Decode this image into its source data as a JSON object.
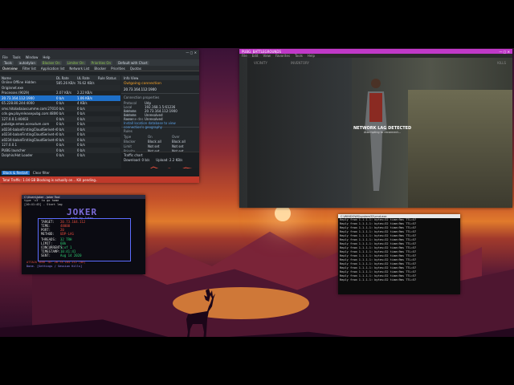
{
  "network_tool": {
    "title": "",
    "menu": [
      "File",
      "Tools",
      "Window",
      "Help"
    ],
    "toolbar_items": [
      "Tools",
      "autodylan",
      "Blocker On",
      "Limiter On",
      "Priorities On",
      "Default with Chart"
    ],
    "tabs": [
      "Overview",
      "Filter list",
      "Application list",
      "Network List",
      "Blocker",
      "Priorities",
      "Quotas"
    ],
    "status_filters": [
      "Online",
      "Offline",
      "Hidden"
    ],
    "columns": [
      "Name",
      "DL Rate",
      "UL Rate",
      "Rule Status"
    ],
    "totals": {
      "dl": "585.26 KB/s",
      "ul": "76.62 KB/s"
    },
    "rows": [
      {
        "name": "Originnet.exe",
        "dl": "",
        "ul": ""
      },
      {
        "name": "Processes (9029)",
        "dl": "2.07 KB/s",
        "ul": "2.22 KB/s"
      },
      {
        "name": "20.73.164.112:1900",
        "dl": "0 b/s",
        "ul": "1.06 KB/s"
      },
      {
        "name": "65.228.80.244:4000",
        "dl": "0 b/s",
        "ul": "4 KB/s"
      },
      {
        "name": "sms.hitoladaiascumme.com:27015",
        "dl": "0 b/s",
        "ul": "0 b/s"
      },
      {
        "name": "cdn.gw.playreleasepubg.com:48000",
        "dl": "0 b/s",
        "ul": "0 b/s"
      },
      {
        "name": "127.0.0.1:40403",
        "dl": "0 b/s",
        "ul": "0 b/s"
      },
      {
        "name": "pubstge.emes.ocesutum.com",
        "dl": "0 b/s",
        "ul": "0 b/s"
      },
      {
        "name": "a0234-balanFirstingCloudSerivet-44",
        "dl": "0 b/s",
        "ul": "0 b/s"
      },
      {
        "name": "a0234-balanFirstingCloudSerivet-44",
        "dl": "0 b/s",
        "ul": "0 b/s"
      },
      {
        "name": "a0234-balanFirstingCloudSerivet-44",
        "dl": "0 b/s",
        "ul": "0 b/s"
      },
      {
        "name": "127.0.0.1",
        "dl": "0 b/s",
        "ul": "0 b/s"
      },
      {
        "name": "PUBG launcher",
        "dl": "0 b/s",
        "ul": "0 b/s"
      },
      {
        "name": "Dolphin/Hot Loader",
        "dl": "0 b/s",
        "ul": "0 b/s"
      }
    ],
    "info_view": {
      "header": "Info View",
      "title": "Outgoing connection",
      "subtitle": "20.73.164.112:1900",
      "section": "Connection properties",
      "props": [
        [
          "Protocol",
          "Udp"
        ],
        [
          "Local address",
          "192.168.1.5:61236"
        ],
        [
          "Remote address",
          "20.73.164.112:1900"
        ],
        [
          "Remote name",
          "Unresolved"
        ],
        [
          "Reverse dns",
          "Unresolved"
        ]
      ],
      "hint": "Install location database to view connection's geography",
      "rules_header": "Rules",
      "rules_cols": [
        "Type",
        "On",
        "Over"
      ],
      "rules": [
        [
          "Blocker",
          "Block all",
          "Block all"
        ],
        [
          "Limit",
          "Not set",
          "Not set"
        ],
        [
          "Priority",
          "Not set",
          "Not set"
        ],
        [
          "Quota",
          "Not set",
          "Not set"
        ]
      ],
      "traffic_chart": "Traffic chart",
      "download_rate": "Download: 0 b/s",
      "upload_rate": "Upload: 2.2 KB/s"
    },
    "bottom_button": "Block & Restart",
    "bottom_filter": "Clear filter",
    "status_bar": "Total Traffic: 1.04 GB   Blocking is actually on... Kill pending.."
  },
  "game": {
    "title": "PUBG: BATTLEGROUNDS",
    "menu": [
      "File",
      "Edit",
      "View",
      "Favorites",
      "Tools",
      "Help"
    ],
    "labels": [
      "VICINITY",
      "INVENTORY"
    ],
    "kills": "KILLS",
    "alert_title": "NETWORK LAG DETECTED",
    "alert_sub": "Attempting to reconnect..."
  },
  "joker": {
    "title": "C:\\Users\\Joker - Joker Tool",
    "prompt1": "type 'c3' to go home",
    "prompt2": "[10:41:43] - Start lag",
    "logo": "JOKER",
    "subtitle": "made by Joker",
    "fields": [
      {
        "k": "TARGET:",
        "v": "20.73.164.112"
      },
      {
        "k": "TIME:",
        "v": "48000"
      },
      {
        "k": "PORT:",
        "v": "20"
      },
      {
        "k": "METHOD:",
        "v": "UDP-LAG"
      }
    ],
    "fields2": [
      {
        "k": "THREADS:",
        "v": "32 TRH"
      },
      {
        "k": "LIMIT:",
        "v": "68k"
      },
      {
        "k": "CONCURRENTS:",
        "v": "1 of 1"
      },
      {
        "k": "TIMESTAMP:",
        "v": "10:41:41"
      },
      {
        "k": "SENT:",
        "v": "Aug 14 2020"
      }
    ],
    "attack_line": "ATTACK SENT TO: 20.73.164.112 (ok)",
    "done_line": "Done. [Settings / Session Kills]"
  },
  "ping": {
    "title": "C:\\WINDOWS\\system32\\cmd.exe",
    "lines": [
      "Reply from 1.1.1.1: bytes=32 time=9ms TTL=57",
      "Reply from 1.1.1.1: bytes=32 time=9ms TTL=57",
      "Reply from 1.1.1.1: bytes=32 time=9ms TTL=57",
      "Reply from 1.1.1.1: bytes=32 time=9ms TTL=57",
      "Reply from 1.1.1.1: bytes=32 time=9ms TTL=57",
      "Reply from 1.1.1.1: bytes=32 time=9ms TTL=57",
      "Reply from 1.1.1.1: bytes=32 time=9ms TTL=57",
      "Reply from 1.1.1.1: bytes=32 time=9ms TTL=57",
      "Reply from 1.1.1.1: bytes=32 time=9ms TTL=57",
      "Reply from 1.1.1.1: bytes=32 time=9ms TTL=57",
      "Reply from 1.1.1.1: bytes=32 time=9ms TTL=57",
      "Reply from 1.1.1.1: bytes=32 time=9ms TTL=57",
      "Reply from 1.1.1.1: bytes=32 time=9ms TTL=57",
      "Reply from 1.1.1.1: bytes=32 time=9ms TTL=57",
      "Reply from 1.1.1.1: bytes=32 time=9ms TTL=57",
      "Reply from 1.1.1.1: bytes=32 time=9ms TTL=57"
    ]
  },
  "colors": {
    "accent": "#1e6fc7",
    "game_title": "#c039c8",
    "status_red": "#c0392b",
    "ok_green": "#8bc34a"
  }
}
